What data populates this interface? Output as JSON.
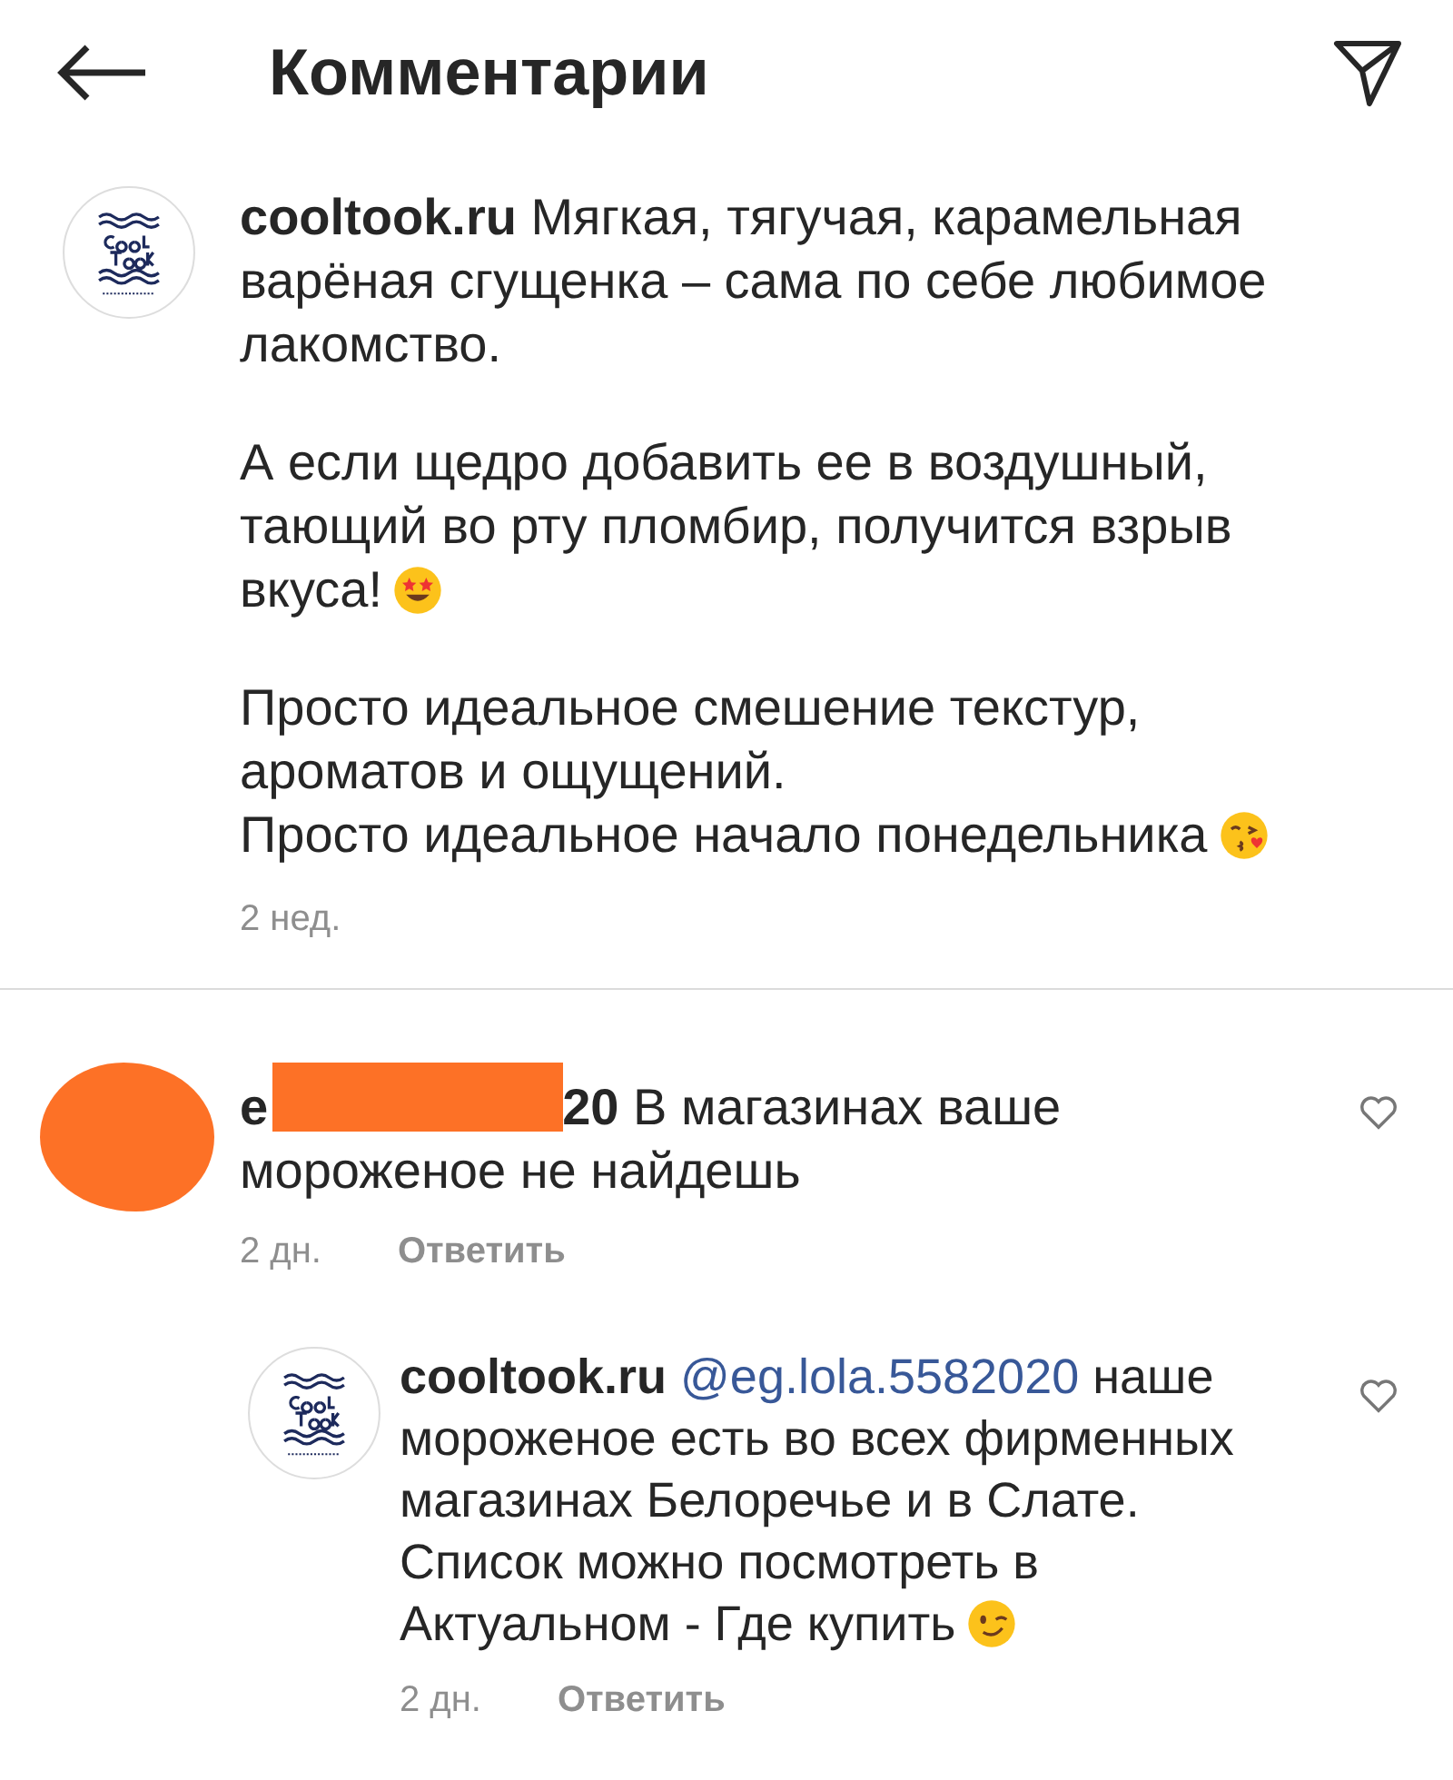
{
  "header": {
    "title": "Комментарии"
  },
  "caption": {
    "author": "cooltook.ru",
    "paragraphs": [
      {
        "text": "Мягкая, тягучая, карамельная варёная сгущенка – сама по себе любимое лакомство."
      },
      {
        "text": "А если щедро добавить ее в воздушный, тающий во рту пломбир, получится взрыв вкуса!",
        "emoji": {
          "kind": "star-eyes"
        }
      },
      {
        "text": "Просто идеальное смешение текстур, ароматов и ощущений.\nПросто идеальное начало понедельника",
        "emoji": {
          "kind": "kiss"
        }
      }
    ],
    "time": "2 нед."
  },
  "comments": [
    {
      "kind": "redacted",
      "author_start": "e",
      "author_end": "20",
      "text": "В магазинах ваше мороженое не найдешь",
      "time": "2 дн.",
      "reply": "Ответить",
      "liked": false,
      "replies": [
        {
          "author": "cooltook.ru",
          "mention": "@eg.lola.5582020",
          "text": "наше мороженое есть во всех фирменных магазинах Белоречье и в Слате. Список можно посмотреть в Актуальном - Где купить",
          "emoji": {
            "kind": "wink"
          },
          "time": "2 дн.",
          "reply": "Ответить",
          "liked": false
        }
      ]
    }
  ]
}
